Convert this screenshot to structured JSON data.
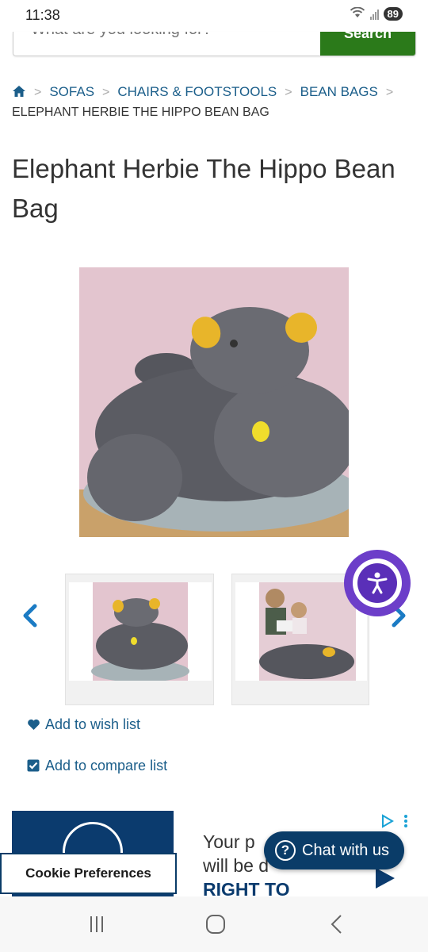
{
  "status_bar": {
    "time": "11:38",
    "battery": "89"
  },
  "search": {
    "placeholder": "What are you looking for?",
    "button_label": "Search"
  },
  "breadcrumb": {
    "items": [
      "SOFAS",
      "CHAIRS & FOOTSTOOLS",
      "BEAN BAGS"
    ],
    "current": "ELEPHANT HERBIE THE HIPPO BEAN BAG"
  },
  "product": {
    "title": "Elephant Herbie The Hippo Bean Bag",
    "wishlist_label": "Add to wish list",
    "compare_label": "Add to compare list"
  },
  "ad": {
    "line1": "Your p",
    "line2": "will be d",
    "line3": "RIGHT TO"
  },
  "chat": {
    "label": "Chat with us"
  },
  "cookie": {
    "label": "Cookie Preferences"
  },
  "colors": {
    "brand_blue": "#0a3c68",
    "link_blue": "#1b5e8a",
    "search_green": "#2b7a1a",
    "a11y_purple": "#6c3ec9"
  }
}
